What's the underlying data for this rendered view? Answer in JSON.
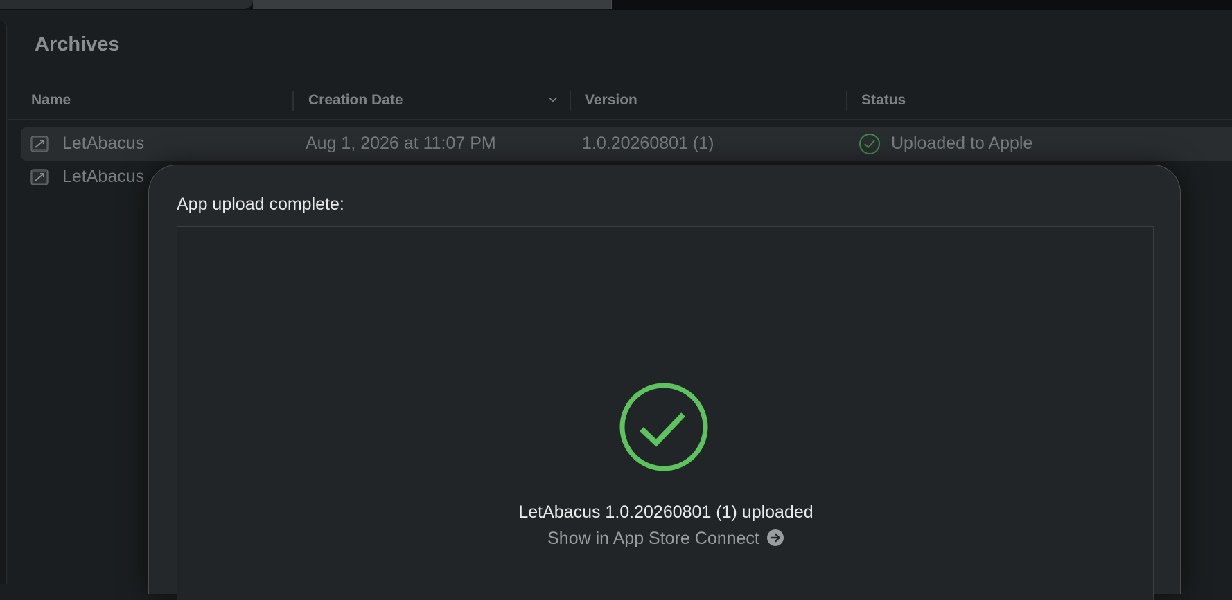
{
  "page": {
    "title": "Archives",
    "columns": {
      "name": "Name",
      "creation_date": "Creation Date",
      "version": "Version",
      "status": "Status"
    },
    "rows": [
      {
        "name": "LetAbacus",
        "creation_date": "Aug 1, 2026 at 11:07 PM",
        "version": "1.0.20260801 (1)",
        "status": "Uploaded to Apple",
        "selected": true
      },
      {
        "name": "LetAbacus",
        "selected": false
      }
    ]
  },
  "sheet": {
    "heading": "App upload complete:",
    "result_text": "LetAbacus 1.0.20260801 (1) uploaded",
    "link_label": "Show in App Store Connect"
  },
  "icons": {
    "archive": "archive-icon",
    "status": "checkmark-circle-icon",
    "success": "checkmark-circle-icon",
    "link": "arrow-right-circle-icon",
    "sort": "chevron-down-icon"
  },
  "colors": {
    "success_green": "#5cc35e",
    "status_green_dim": "#3f8a45"
  }
}
